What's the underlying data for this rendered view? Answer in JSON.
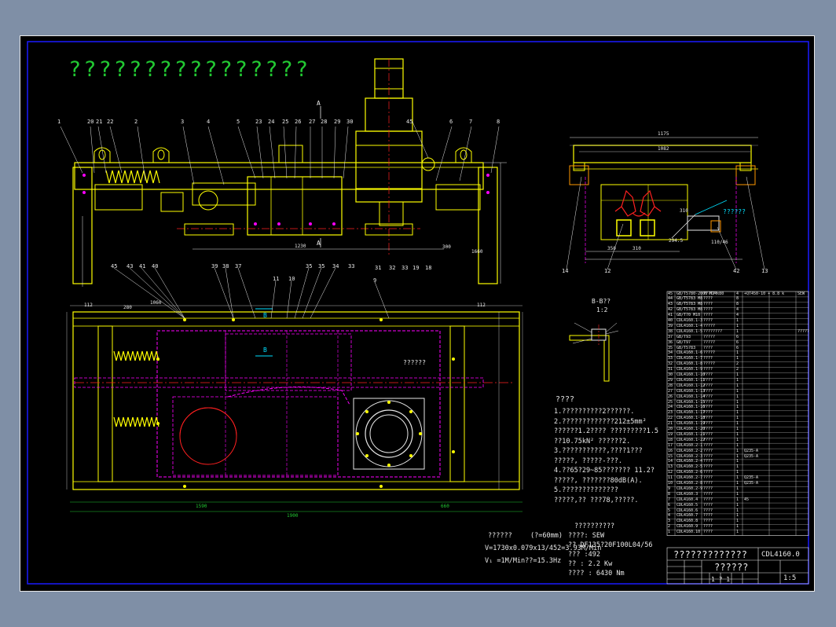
{
  "drawing": {
    "title": "????????????????",
    "section_title": "B-B??",
    "section_scale": "1:2",
    "annotation_label": "??????",
    "right_annotation": "??????",
    "section_markers": [
      "A",
      "A",
      "B",
      "B"
    ]
  },
  "tech_requirements": {
    "heading": "????",
    "lines": [
      "1.??????????2??????.",
      "2.?????????????212±5mm²",
      "  ??????1.2????  ?????????1.5",
      "  ??10.75kN²  ??????2.",
      "3.???????????,????1???",
      "  ?????,  ?????-???.",
      "4.??65?29~85??????? 11.2?",
      "  ?????,  ???????80dB(A).",
      "5.??????????????",
      "  ?????,??  ???78,?????."
    ]
  },
  "speed_calc": {
    "heading": "??????",
    "note": "(?=60mm)",
    "line1": "V=1730x0.079x13/452=3.93M/Min",
    "line2": "V₁ =1M/Min??=15.3Hz"
  },
  "motor_params": {
    "heading": "??????????",
    "model": "????:   SEW",
    "spec": "??  DF135?20F100L04/56",
    "ratio": "???  :492",
    "power": "??  : 2.2 Kw",
    "torque": "????  : 6430 Nm"
  },
  "title_block": {
    "name": "?????????????",
    "drawing_number": "CDL4160.0",
    "drawing_name": "??????",
    "scale": "1:5",
    "sheet": "1  ?  1"
  },
  "balloons_front": [
    "1",
    "20",
    "21",
    "22",
    "2",
    "3",
    "4",
    "5",
    "23",
    "24",
    "25",
    "26",
    "27",
    "28",
    "29",
    "30",
    "45",
    "6",
    "7",
    "8"
  ],
  "balloons_front_bottom": [
    "31",
    "32",
    "33",
    "19",
    "18"
  ],
  "balloons_plan": [
    "45",
    "43",
    "41",
    "40",
    "39",
    "38",
    "37",
    "11",
    "10",
    "35",
    "35",
    "34",
    "33",
    "9"
  ],
  "balloons_side": [
    "14",
    "12",
    "42",
    "13"
  ],
  "dimensions": {
    "front": [
      "1230",
      "300",
      "1660"
    ],
    "plan": [
      "112",
      "1060",
      "280",
      "112",
      "1590",
      "1900",
      "660"
    ],
    "side": [
      "1175",
      "1082",
      "350",
      "310",
      "310",
      "294.5",
      "110/46"
    ]
  },
  "bom_rows": [
    {
      "no": "45",
      "code": "GB/T5780-2000 M24x80",
      "name": "??????",
      "qty": "4",
      "mat": "+QT450-10 + 8.8 k",
      "note": "SEW"
    },
    {
      "no": "44",
      "code": "GB/T5783 M8",
      "name": "????",
      "qty": "8",
      "mat": "",
      "note": ""
    },
    {
      "no": "43",
      "code": "GB/T5783 M8",
      "name": "????",
      "qty": "8",
      "mat": "",
      "note": ""
    },
    {
      "no": "42",
      "code": "GB/T5783 M8",
      "name": "????",
      "qty": "4",
      "mat": "",
      "note": ""
    },
    {
      "no": "41",
      "code": "GB/T70 M10",
      "name": "????",
      "qty": "4",
      "mat": "",
      "note": ""
    },
    {
      "no": "40",
      "code": "CDL4160.1-3",
      "name": "????",
      "qty": "1",
      "mat": "",
      "note": ""
    },
    {
      "no": "39",
      "code": "CDL4160.1-4",
      "name": "?????",
      "qty": "1",
      "mat": "",
      "note": ""
    },
    {
      "no": "38",
      "code": "CDL4160.1-5",
      "name": "????????",
      "qty": "1",
      "mat": "",
      "note": "?????"
    },
    {
      "no": "37",
      "code": "GB/T93",
      "name": "?????",
      "qty": "6",
      "mat": "",
      "note": ""
    },
    {
      "no": "36",
      "code": "GB/T97",
      "name": "?????",
      "qty": "6",
      "mat": "",
      "note": ""
    },
    {
      "no": "35",
      "code": "GB/T5783",
      "name": "????",
      "qty": "6",
      "mat": "",
      "note": ""
    },
    {
      "no": "34",
      "code": "CDL4160.1-6",
      "name": "?????",
      "qty": "1",
      "mat": "",
      "note": ""
    },
    {
      "no": "33",
      "code": "CDL4160.1-7",
      "name": "????",
      "qty": "1",
      "mat": "",
      "note": ""
    },
    {
      "no": "32",
      "code": "CDL4160.1-8",
      "name": "?????",
      "qty": "2",
      "mat": "",
      "note": ""
    },
    {
      "no": "31",
      "code": "CDL4160.1-9",
      "name": "????",
      "qty": "2",
      "mat": "",
      "note": ""
    },
    {
      "no": "30",
      "code": "CDL4160.1-10",
      "name": "????",
      "qty": "1",
      "mat": "",
      "note": ""
    },
    {
      "no": "29",
      "code": "CDL4160.1-11",
      "name": "????",
      "qty": "1",
      "mat": "",
      "note": ""
    },
    {
      "no": "28",
      "code": "CDL4160.1-12",
      "name": "????",
      "qty": "1",
      "mat": "",
      "note": ""
    },
    {
      "no": "27",
      "code": "CDL4160.1-13",
      "name": "????",
      "qty": "1",
      "mat": "",
      "note": ""
    },
    {
      "no": "26",
      "code": "CDL4160.1-14",
      "name": "????",
      "qty": "1",
      "mat": "",
      "note": ""
    },
    {
      "no": "25",
      "code": "CDL4160.1-15",
      "name": "????",
      "qty": "1",
      "mat": "",
      "note": ""
    },
    {
      "no": "24",
      "code": "CDL4160.1-16",
      "name": "????",
      "qty": "1",
      "mat": "",
      "note": ""
    },
    {
      "no": "23",
      "code": "CDL4160.1-17",
      "name": "????",
      "qty": "1",
      "mat": "",
      "note": ""
    },
    {
      "no": "22",
      "code": "CDL4160.1-18",
      "name": "????",
      "qty": "1",
      "mat": "",
      "note": ""
    },
    {
      "no": "21",
      "code": "CDL4160.1-19",
      "name": "????",
      "qty": "1",
      "mat": "",
      "note": ""
    },
    {
      "no": "20",
      "code": "CDL4160.1-20",
      "name": "????",
      "qty": "1",
      "mat": "",
      "note": ""
    },
    {
      "no": "19",
      "code": "CDL4160.1-21",
      "name": "????",
      "qty": "1",
      "mat": "",
      "note": ""
    },
    {
      "no": "18",
      "code": "CDL4160.1-22",
      "name": "????",
      "qty": "1",
      "mat": "",
      "note": ""
    },
    {
      "no": "17",
      "code": "CDL4160.2-1",
      "name": "????",
      "qty": "1",
      "mat": "",
      "note": ""
    },
    {
      "no": "16",
      "code": "CDL4160.2-2",
      "name": "????",
      "qty": "1",
      "mat": "Q235-A",
      "note": ""
    },
    {
      "no": "15",
      "code": "CDL4160.2-3",
      "name": "????",
      "qty": "1",
      "mat": "Q235-A",
      "note": ""
    },
    {
      "no": "14",
      "code": "CDL4160.2-4",
      "name": "????",
      "qty": "1",
      "mat": "",
      "note": ""
    },
    {
      "no": "13",
      "code": "CDL4160.2-5",
      "name": "????",
      "qty": "1",
      "mat": "",
      "note": ""
    },
    {
      "no": "12",
      "code": "CDL4160.2-6",
      "name": "????",
      "qty": "1",
      "mat": "",
      "note": ""
    },
    {
      "no": "11",
      "code": "CDL4160.2-7",
      "name": "????",
      "qty": "1",
      "mat": "Q235-A",
      "note": ""
    },
    {
      "no": "10",
      "code": "CDL4160.2-8",
      "name": "????",
      "qty": "1",
      "mat": "Q235-A",
      "note": ""
    },
    {
      "no": "9",
      "code": "CDL4160.2-9",
      "name": "????",
      "qty": "1",
      "mat": "",
      "note": ""
    },
    {
      "no": "8",
      "code": "CDL4160.3",
      "name": "????",
      "qty": "1",
      "mat": "",
      "note": ""
    },
    {
      "no": "7",
      "code": "CDL4160.4",
      "name": "????",
      "qty": "1",
      "mat": "45",
      "note": ""
    },
    {
      "no": "6",
      "code": "CDL4160.5",
      "name": "????",
      "qty": "1",
      "mat": "",
      "note": ""
    },
    {
      "no": "5",
      "code": "CDL4160.6",
      "name": "????",
      "qty": "1",
      "mat": "",
      "note": ""
    },
    {
      "no": "4",
      "code": "CDL4160.7",
      "name": "????",
      "qty": "1",
      "mat": "",
      "note": ""
    },
    {
      "no": "3",
      "code": "CDL4160.8",
      "name": "????",
      "qty": "1",
      "mat": "",
      "note": ""
    },
    {
      "no": "2",
      "code": "CDL4160.9",
      "name": "????",
      "qty": "1",
      "mat": "",
      "note": ""
    },
    {
      "no": "1",
      "code": "CDL4160.10",
      "name": "????",
      "qty": "1",
      "mat": "",
      "note": ""
    }
  ],
  "colors": {
    "sheet": "#000000",
    "frame": "#1a1aff",
    "yellow": "#ffff00",
    "white": "#e8e8e8",
    "magenta": "#ff00ff",
    "red": "#ff2020",
    "green": "#22c832",
    "cyan": "#00e0ff",
    "orange": "#ff9900"
  }
}
